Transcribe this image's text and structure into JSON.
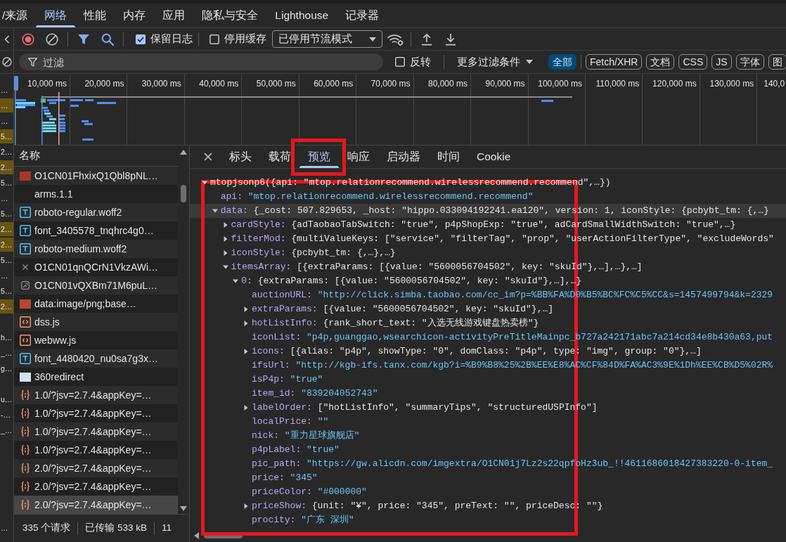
{
  "top_tabs": [
    {
      "label": "/来源",
      "selected": false
    },
    {
      "label": "网络",
      "selected": true
    },
    {
      "label": "性能",
      "selected": false
    },
    {
      "label": "内存",
      "selected": false
    },
    {
      "label": "应用",
      "selected": false
    },
    {
      "label": "隐私与安全",
      "selected": false
    },
    {
      "label": "Lighthouse",
      "selected": false
    },
    {
      "label": "记录器",
      "selected": false
    }
  ],
  "toolbar": {
    "preserve_log": {
      "label": "保留日志",
      "checked": true
    },
    "disable_cache": {
      "label": "停用缓存",
      "checked": false
    },
    "throttling": "已停用节流模式"
  },
  "filter_bar": {
    "placeholder": "过滤",
    "invert": {
      "label": "反转",
      "checked": false
    },
    "more_filters": "更多过滤条件",
    "types": [
      {
        "label": "全部",
        "selected": true
      },
      {
        "label": "Fetch/XHR",
        "selected": false
      },
      {
        "label": "文档",
        "selected": false
      },
      {
        "label": "CSS",
        "selected": false
      },
      {
        "label": "JS",
        "selected": false
      },
      {
        "label": "字体",
        "selected": false
      },
      {
        "label": "图",
        "selected": false
      }
    ]
  },
  "left_strip": {
    "rows": [
      {
        "text": "…",
        "highlighted": false
      },
      {
        "text": "…",
        "highlighted": true
      },
      {
        "text": "…",
        "highlighted": false
      },
      {
        "text": "5…",
        "highlighted": true
      },
      {
        "text": "2…",
        "highlighted": false
      },
      {
        "text": "2…",
        "highlighted": true
      },
      {
        "text": "5…",
        "highlighted": false
      },
      {
        "text": "…",
        "highlighted": false
      },
      {
        "text": "5…",
        "highlighted": false
      },
      {
        "text": "2…",
        "highlighted": true
      },
      {
        "text": "2…",
        "highlighted": true
      },
      {
        "text": "5…",
        "highlighted": false
      },
      {
        "text": "…",
        "highlighted": false
      },
      {
        "text": "5…",
        "highlighted": false
      },
      {
        "text": "2…",
        "highlighted": true
      },
      {
        "highlighted": false
      },
      {
        "text": "h…",
        "highlighted": false
      },
      {
        "text": "_…",
        "highlighted": false
      },
      {
        "text": "g…",
        "highlighted": false
      },
      {
        "highlighted": false
      },
      {
        "text": "u…",
        "highlighted": false
      },
      {
        "text": "-…",
        "highlighted": false
      },
      {
        "text": "_…",
        "highlighted": false
      }
    ],
    "footer": "…"
  },
  "timeline": {
    "ticks": [
      "10,000 ms",
      "20,000 ms",
      "30,000 ms",
      "40,000 ms",
      "50,000 ms",
      "60,000 ms",
      "70,000 ms",
      "80,000 ms",
      "90,000 ms",
      "100,000 ms",
      "110,000 ms",
      "120,000 ms",
      "130,000 ms",
      "140,0"
    ]
  },
  "requests": {
    "header": "名称",
    "rows": [
      {
        "name": "O1CN01FhxixQ1Qbl8pNL…",
        "kind": "image",
        "color": "#a8372a",
        "selected": false
      },
      {
        "name": "arms.1.1",
        "kind": "other",
        "selected": false
      },
      {
        "name": "roboto-regular.woff2",
        "kind": "font",
        "selected": false
      },
      {
        "name": "font_3405578_tnqhrc4g0…",
        "kind": "font",
        "selected": false
      },
      {
        "name": "roboto-medium.woff2",
        "kind": "font",
        "selected": false
      },
      {
        "name": "O1CN01qnQCrN1VkzAWi…",
        "kind": "failed",
        "selected": false
      },
      {
        "name": "O1CN01vQXBm71M6puL…",
        "kind": "broken-image",
        "selected": false
      },
      {
        "name": "data:image/png;base…",
        "kind": "image",
        "color": "#b4472f",
        "selected": false
      },
      {
        "name": "dss.js",
        "kind": "script",
        "selected": false
      },
      {
        "name": "webww.js",
        "kind": "script",
        "selected": false
      },
      {
        "name": "font_4480420_nu0sa7g3x…",
        "kind": "font",
        "selected": false
      },
      {
        "name": "360redirect",
        "kind": "image",
        "color": "#cfe2ee",
        "selected": false
      },
      {
        "name": "1.0/?jsv=2.7.4&appKey=…",
        "kind": "json",
        "selected": false
      },
      {
        "name": "1.0/?jsv=2.7.4&appKey=…",
        "kind": "json",
        "selected": false
      },
      {
        "name": "1.0/?jsv=2.7.4&appKey=…",
        "kind": "json",
        "selected": false
      },
      {
        "name": "1.0/?jsv=2.7.4&appKey=…",
        "kind": "json",
        "selected": false
      },
      {
        "name": "2.0/?jsv=2.7.4&appKey=…",
        "kind": "json",
        "selected": false
      },
      {
        "name": "2.0/?jsv=2.7.4&appKey=…",
        "kind": "json",
        "selected": false
      },
      {
        "name": "2.0/?jsv=2.7.4&appKey=…",
        "kind": "json",
        "selected": true
      }
    ]
  },
  "status_bar": [
    "335 个请求",
    "已传输 533 kB",
    "11"
  ],
  "details": {
    "tabs": [
      {
        "label": "标头",
        "selected": false,
        "highlighted": false
      },
      {
        "label": "载荷",
        "selected": false,
        "highlighted": false
      },
      {
        "label": "预览",
        "selected": true,
        "highlighted": true
      },
      {
        "label": "响应",
        "selected": false,
        "highlighted": false
      },
      {
        "label": "启动器",
        "selected": false,
        "highlighted": false
      },
      {
        "label": "时间",
        "selected": false,
        "highlighted": false
      },
      {
        "label": "Cookie",
        "selected": false,
        "highlighted": false
      }
    ],
    "preview": {
      "highlighted": true,
      "tree": [
        {
          "kind": "object",
          "value": "mtopjsonp6({api: \"mtop.relationrecommend.wirelessrecommend.recommend\",…})",
          "expanded": true,
          "hovered": false,
          "children": [
            {
              "key": "api:",
              "kind": "string",
              "value": "\"mtop.relationrecommend.wirelessrecommend.recommend\"",
              "hovered": false
            },
            {
              "key": "data:",
              "kind": "object",
              "value": "{_cost: 507.829653, _host: \"hippo.033094192241.ea120\", version: 1, iconStyle: {pcbybt_tm: {,…}",
              "expanded": true,
              "hovered": true,
              "children": [
                {
                  "key": "cardStyle:",
                  "kind": "object",
                  "value": "{adTaobaoTabSwitch: \"true\", p4pShopExp: \"true\", adCardSmallWidthSwitch: \"true\",…}",
                  "expanded": false,
                  "hovered": false
                },
                {
                  "key": "filterMod:",
                  "kind": "object",
                  "value": "{multiValueKeys: [\"service\", \"filterTag\", \"prop\", \"userActionFilterType\", \"excludeWords\"",
                  "expanded": false,
                  "hovered": false
                },
                {
                  "key": "iconStyle:",
                  "kind": "object",
                  "value": "{pcbybt_tm: {,…},…}",
                  "expanded": false,
                  "hovered": false
                },
                {
                  "key": "itemsArray:",
                  "kind": "object",
                  "value": "[{extraParams: [{value: \"5600056704502\", key: \"skuId\"},…],…},…]",
                  "expanded": true,
                  "hovered": false,
                  "children": [
                    {
                      "key": "0:",
                      "kind": "object",
                      "value": "{extraParams: [{value: \"5600056704502\", key: \"skuId\"},…],…}",
                      "expanded": true,
                      "hovered": false,
                      "children": [
                        {
                          "key": "auctionURL:",
                          "kind": "string",
                          "value": "\"http://click.simba.taobao.com/cc_im?p=%BB%FA%D0%B5%BC%FC%C5%CC&s=1457499794&k=2329",
                          "hovered": false
                        },
                        {
                          "key": "extraParams:",
                          "kind": "object",
                          "value": "[{value: \"5600056704502\", key: \"skuId\"},…]",
                          "expanded": false,
                          "hovered": false
                        },
                        {
                          "key": "hotListInfo:",
                          "kind": "object",
                          "value": "{rank_short_text: \"入选无线游戏键盘热卖榜\"}",
                          "expanded": false,
                          "hovered": false
                        },
                        {
                          "key": "iconList:",
                          "kind": "string",
                          "value": "\"p4p,guanggao,wsearchicon-activityPreTitleMainpc_b727a242171abc7a214cd34e8b430a63,put",
                          "hovered": false
                        },
                        {
                          "key": "icons:",
                          "kind": "object",
                          "value": "[{alias: \"p4p\", showType: \"0\", domClass: \"p4p\", type: \"img\", group: \"0\"},…]",
                          "expanded": false,
                          "hovered": false
                        },
                        {
                          "key": "ifsUrl:",
                          "kind": "string",
                          "value": "\"http://kgb-ifs.tanx.com/kgb?i=%B9%B8%25%2B%EE%E8%AC%CF%84D%FA%AC3%9E%1Dh%EE%CB%D5%02R%",
                          "hovered": false
                        },
                        {
                          "key": "isP4p:",
                          "kind": "string",
                          "value": "\"true\"",
                          "hovered": false
                        },
                        {
                          "key": "item_id:",
                          "kind": "string",
                          "value": "\"839204052743\"",
                          "hovered": false
                        },
                        {
                          "key": "labelOrder:",
                          "kind": "object",
                          "value": "[\"hotListInfo\", \"summaryTips\", \"structuredUSPInfo\"]",
                          "expanded": false,
                          "hovered": false
                        },
                        {
                          "key": "localPrice:",
                          "kind": "string",
                          "value": "\"\"",
                          "hovered": false
                        },
                        {
                          "key": "nick:",
                          "kind": "string",
                          "value": "\"重力星球旗舰店\"",
                          "hovered": false
                        },
                        {
                          "key": "p4pLabel:",
                          "kind": "string",
                          "value": "\"true\"",
                          "hovered": false
                        },
                        {
                          "key": "pic_path:",
                          "kind": "string",
                          "value": "\"https://gw.alicdn.com/imgextra/O1CN01j7Lz2s22qpfoHz3ub_!!4611686018427383220-0-item_",
                          "hovered": false
                        },
                        {
                          "key": "price:",
                          "kind": "string",
                          "value": "\"345\"",
                          "hovered": false
                        },
                        {
                          "key": "priceColor:",
                          "kind": "string",
                          "value": "\"#000000\"",
                          "hovered": false
                        },
                        {
                          "key": "priceShow:",
                          "kind": "object",
                          "value": "{unit: \"¥\", price: \"345\", preText: \"\", priceDesc: \"\"}",
                          "expanded": false,
                          "hovered": false
                        },
                        {
                          "key": "procity:",
                          "kind": "string",
                          "value": "\"广东 深圳\"",
                          "hovered": false
                        }
                      ]
                    }
                  ]
                }
              ]
            }
          ]
        }
      ]
    }
  }
}
